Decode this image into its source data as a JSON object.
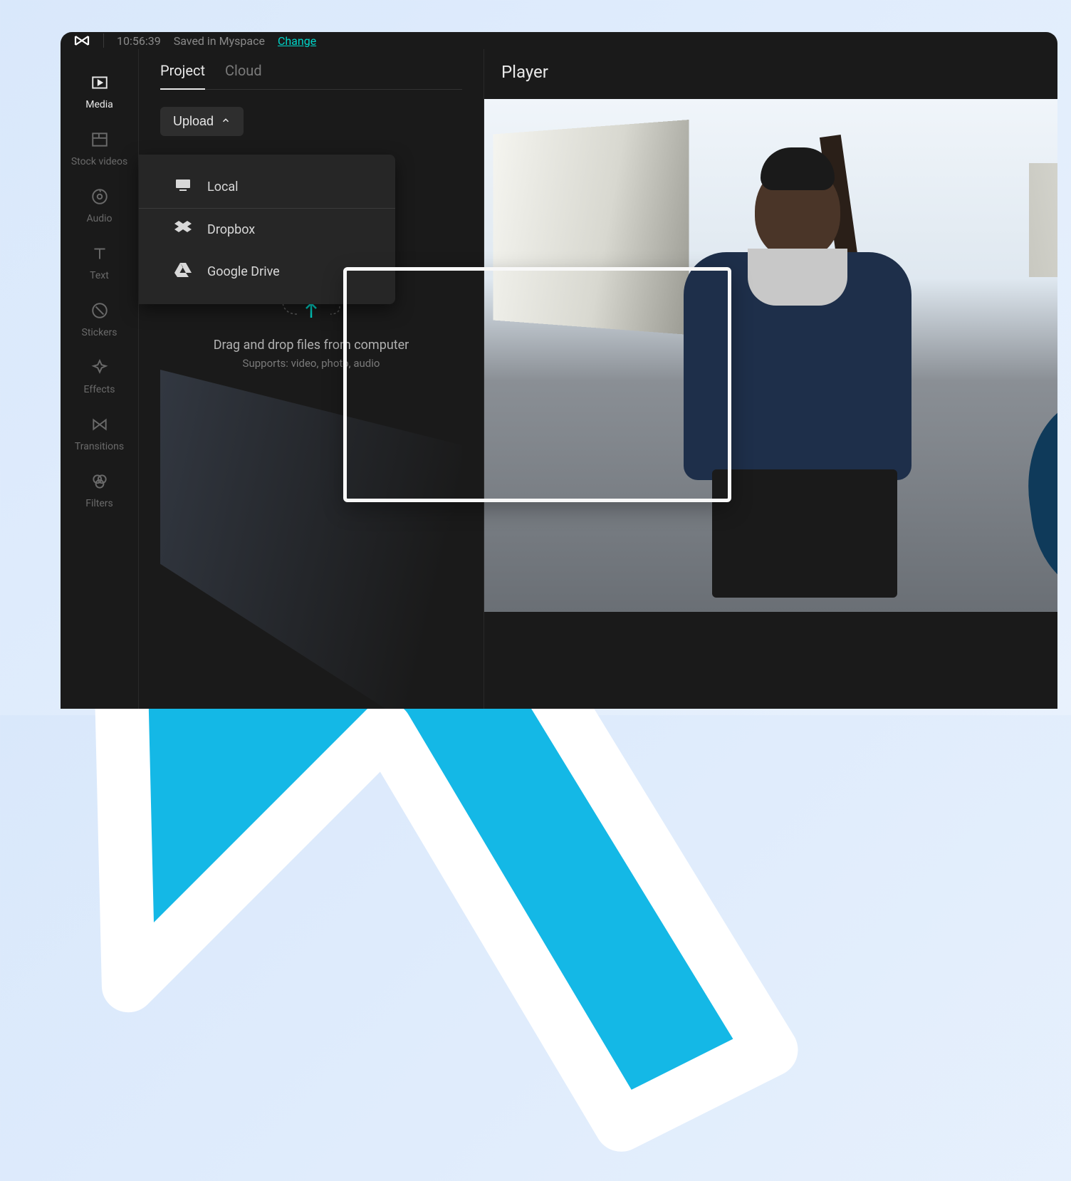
{
  "topbar": {
    "timestamp": "10:56:39",
    "saved_text": "Saved in Myspace",
    "change_link": "Change"
  },
  "sidebar": {
    "items": [
      {
        "label": "Media",
        "icon": "media-icon",
        "active": true
      },
      {
        "label": "Stock videos",
        "icon": "stock-videos-icon",
        "active": false
      },
      {
        "label": "Audio",
        "icon": "audio-icon",
        "active": false
      },
      {
        "label": "Text",
        "icon": "text-icon",
        "active": false
      },
      {
        "label": "Stickers",
        "icon": "stickers-icon",
        "active": false
      },
      {
        "label": "Effects",
        "icon": "effects-icon",
        "active": false
      },
      {
        "label": "Transitions",
        "icon": "transitions-icon",
        "active": false
      },
      {
        "label": "Filters",
        "icon": "filters-icon",
        "active": false
      }
    ]
  },
  "panel": {
    "tabs": {
      "project": "Project",
      "cloud": "Cloud"
    },
    "upload_label": "Upload",
    "upload_menu": [
      {
        "label": "Local",
        "icon": "local-icon"
      },
      {
        "label": "Dropbox",
        "icon": "dropbox-icon"
      },
      {
        "label": "Google Drive",
        "icon": "google-drive-icon"
      }
    ],
    "drop_title": "Drag and drop files from computer",
    "drop_sub": "Supports: video, photo, audio"
  },
  "player": {
    "title": "Player"
  },
  "colors": {
    "accent": "#00d4c8",
    "bg_dark": "#1a1a1a",
    "bg_panel": "#262626",
    "cursor": "#14b8e6"
  }
}
